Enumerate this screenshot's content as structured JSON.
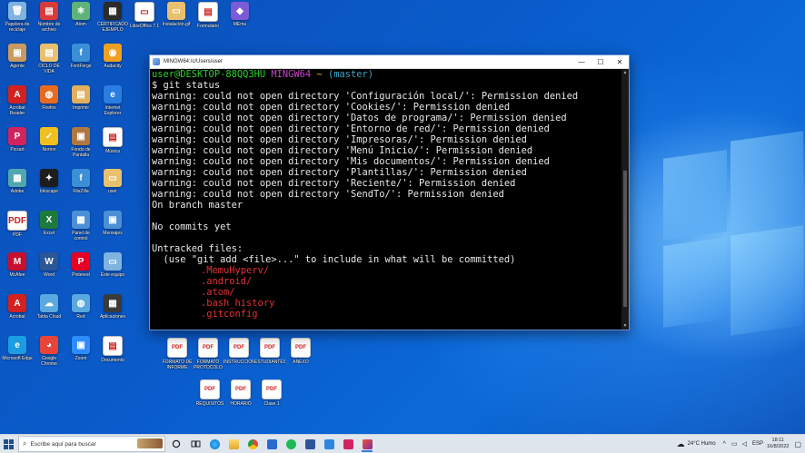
{
  "terminal": {
    "title": "MINGW64:/c/Users/user",
    "buttons": {
      "minimize": "—",
      "maximize": "☐",
      "close": "✕"
    },
    "prompt": {
      "user_host": "user@DESKTOP-88QQ3HU",
      "shell": "MINGW64",
      "path": "~",
      "branch": "(master)"
    },
    "command": "$ git status",
    "warnings": [
      "warning: could not open directory 'Configuración local/': Permission denied",
      "warning: could not open directory 'Cookies/': Permission denied",
      "warning: could not open directory 'Datos de programa/': Permission denied",
      "warning: could not open directory 'Entorno de red/': Permission denied",
      "warning: could not open directory 'Impresoras/': Permission denied",
      "warning: could not open directory 'Menú Inicio/': Permission denied",
      "warning: could not open directory 'Mis documentos/': Permission denied",
      "warning: could not open directory 'Plantillas/': Permission denied",
      "warning: could not open directory 'Reciente/': Permission denied",
      "warning: could not open directory 'SendTo/': Permission denied"
    ],
    "branch_line": "On branch master",
    "no_commits": "No commits yet",
    "untracked_header": "Untracked files:",
    "untracked_hint": "  (use \"git add <file>...\" to include in what will be committed)",
    "untracked_files": [
      ".MemuHyperv/",
      ".android/",
      ".atom/",
      ".bash_history",
      ".gitconfig"
    ]
  },
  "desktop": {
    "icons": [
      {
        "label": "Papelera de reciclaje",
        "glyph": "🗑",
        "color": "#7fb3e0"
      },
      {
        "label": "Nombre de archivo",
        "glyph": "▤",
        "color": "#d93a3a"
      },
      {
        "label": "Atom",
        "glyph": "⚛",
        "color": "#5fb37a"
      },
      {
        "label": "CERTIFICADO EJEMPLO",
        "glyph": "▦",
        "color": "#2b2b2b"
      },
      {
        "label": "LibreOffice 7.1",
        "glyph": "▭",
        "color": "#ffffff"
      },
      {
        "label": "Instalación.gif",
        "glyph": "▭",
        "color": "#e8c070"
      },
      {
        "label": "Formulario",
        "glyph": "▤",
        "color": "#ffffff"
      },
      {
        "label": "MEmu",
        "glyph": "◆",
        "color": "#7a5cd6"
      },
      {
        "label": "Agente",
        "glyph": "▣",
        "color": "#c89a60"
      },
      {
        "label": "CICLO DE VIDA",
        "glyph": "▤",
        "color": "#e8c070"
      },
      {
        "label": "FontForge",
        "glyph": "f",
        "color": "#3a8fd6"
      },
      {
        "label": "Audacity",
        "glyph": "◉",
        "color": "#f0a020"
      },
      {
        "label": "Acrobat Reader",
        "glyph": "A",
        "color": "#d32020"
      },
      {
        "label": "Firefox",
        "glyph": "◍",
        "color": "#e86a20"
      },
      {
        "label": "Imprimir",
        "glyph": "▤",
        "color": "#e0b060"
      },
      {
        "label": "Internet Explorer",
        "glyph": "e",
        "color": "#2a7de1"
      },
      {
        "label": "Picsart",
        "glyph": "P",
        "color": "#d0245e"
      },
      {
        "label": "Norton",
        "glyph": "✓",
        "color": "#f0c020"
      },
      {
        "label": "Fondo de Pantalla",
        "glyph": "▣",
        "color": "#b07840"
      },
      {
        "label": "Música",
        "glyph": "▤",
        "color": "#ffffff"
      },
      {
        "label": "Adobe",
        "glyph": "▦",
        "color": "#4fa8b0"
      },
      {
        "label": "Inkscape",
        "glyph": "✦",
        "color": "#1d1d1d"
      },
      {
        "label": "FileZilla",
        "glyph": "f",
        "color": "#3a8fd6"
      },
      {
        "label": "user",
        "glyph": "▭",
        "color": "#e8c070"
      },
      {
        "label": "PDF",
        "glyph": "PDF",
        "color": "#ffffff"
      },
      {
        "label": "Excel",
        "glyph": "X",
        "color": "#1d7a3f"
      },
      {
        "label": "Panel de control",
        "glyph": "▦",
        "color": "#4c8fd6"
      },
      {
        "label": "Mensajes",
        "glyph": "▣",
        "color": "#4c8fd6"
      },
      {
        "label": "McAfee",
        "glyph": "M",
        "color": "#c8102e"
      },
      {
        "label": "Word",
        "glyph": "W",
        "color": "#2b5797"
      },
      {
        "label": "Pinterest",
        "glyph": "P",
        "color": "#e60023"
      },
      {
        "label": "Este equipo",
        "glyph": "▭",
        "color": "#7fb3e0"
      },
      {
        "label": "Acrobat",
        "glyph": "A",
        "color": "#d32020"
      },
      {
        "label": "Tabla Cloud",
        "glyph": "☁",
        "color": "#5aa8e0"
      },
      {
        "label": "Red",
        "glyph": "◍",
        "color": "#5aa8e0"
      },
      {
        "label": "Aplicaciones",
        "glyph": "▦",
        "color": "#3a3a3a"
      },
      {
        "label": "Microsoft Edge",
        "glyph": "e",
        "color": "#1b9de2"
      },
      {
        "label": "Google Chrome",
        "glyph": "◕",
        "color": "#e8443a"
      },
      {
        "label": "Zoom",
        "glyph": "▣",
        "color": "#2d8cff"
      },
      {
        "label": "Documento",
        "glyph": "▤",
        "color": "#ffffff"
      },
      {
        "label": "Spotify",
        "glyph": "♫",
        "color": "#1db954"
      },
      {
        "label": "Teams",
        "glyph": "T",
        "color": "#5059c9"
      }
    ],
    "bottom_pdf_labels": [
      "FORMATO DE INFORME",
      "FORMATO PROTOCOLO",
      "INSTRUCCIONES",
      "ESTUDIANTES",
      "ANEXO",
      "REQUISITOS",
      "HORARIO",
      "Clase 1"
    ]
  },
  "taskbar": {
    "search_placeholder": "Escribe aquí para buscar",
    "weather": "24°C  Humo",
    "language": "ESP",
    "time": "18:11",
    "date": "16/8/2022"
  }
}
